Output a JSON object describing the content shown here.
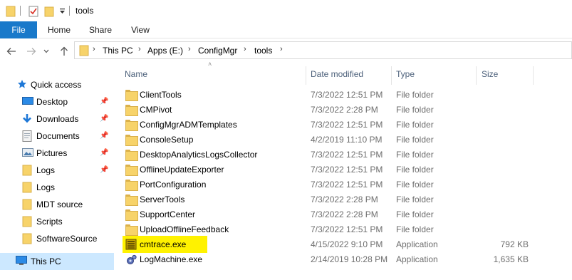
{
  "window": {
    "title": "tools"
  },
  "ribbon": {
    "tabs": [
      "File",
      "Home",
      "Share",
      "View"
    ]
  },
  "address": {
    "path": [
      "This PC",
      "Apps (E:)",
      "ConfigMgr",
      "tools"
    ]
  },
  "nav_pane": {
    "quick_access": "Quick access",
    "items": [
      {
        "label": "Desktop",
        "icon": "desktop-icon",
        "pinned": true
      },
      {
        "label": "Downloads",
        "icon": "downloads-icon",
        "pinned": true
      },
      {
        "label": "Documents",
        "icon": "documents-icon",
        "pinned": true
      },
      {
        "label": "Pictures",
        "icon": "pictures-icon",
        "pinned": true
      },
      {
        "label": "Logs",
        "icon": "folder-icon",
        "pinned": true
      },
      {
        "label": "Logs",
        "icon": "folder-icon",
        "pinned": false
      },
      {
        "label": "MDT source",
        "icon": "folder-icon",
        "pinned": false
      },
      {
        "label": "Scripts",
        "icon": "folder-icon",
        "pinned": false
      },
      {
        "label": "SoftwareSource",
        "icon": "folder-icon",
        "pinned": false
      }
    ],
    "this_pc": "This PC"
  },
  "file_list": {
    "columns": [
      "Name",
      "Date modified",
      "Type",
      "Size"
    ],
    "rows": [
      {
        "name": "ClientTools",
        "date": "7/3/2022 12:51 PM",
        "type": "File folder",
        "size": "",
        "icon": "folder-icon"
      },
      {
        "name": "CMPivot",
        "date": "7/3/2022 2:28 PM",
        "type": "File folder",
        "size": "",
        "icon": "folder-icon"
      },
      {
        "name": "ConfigMgrADMTemplates",
        "date": "7/3/2022 12:51 PM",
        "type": "File folder",
        "size": "",
        "icon": "folder-icon"
      },
      {
        "name": "ConsoleSetup",
        "date": "4/2/2019 11:10 PM",
        "type": "File folder",
        "size": "",
        "icon": "folder-icon"
      },
      {
        "name": "DesktopAnalyticsLogsCollector",
        "date": "7/3/2022 12:51 PM",
        "type": "File folder",
        "size": "",
        "icon": "folder-icon"
      },
      {
        "name": "OfflineUpdateExporter",
        "date": "7/3/2022 12:51 PM",
        "type": "File folder",
        "size": "",
        "icon": "folder-icon"
      },
      {
        "name": "PortConfiguration",
        "date": "7/3/2022 12:51 PM",
        "type": "File folder",
        "size": "",
        "icon": "folder-icon"
      },
      {
        "name": "ServerTools",
        "date": "7/3/2022 2:28 PM",
        "type": "File folder",
        "size": "",
        "icon": "folder-icon"
      },
      {
        "name": "SupportCenter",
        "date": "7/3/2022 2:28 PM",
        "type": "File folder",
        "size": "",
        "icon": "folder-icon"
      },
      {
        "name": "UploadOfflineFeedback",
        "date": "7/3/2022 12:51 PM",
        "type": "File folder",
        "size": "",
        "icon": "folder-icon"
      },
      {
        "name": "cmtrace.exe",
        "date": "4/15/2022 9:10 PM",
        "type": "Application",
        "size": "792 KB",
        "icon": "cmtrace-app-icon",
        "highlighted": true
      },
      {
        "name": "LogMachine.exe",
        "date": "2/14/2019 10:28 PM",
        "type": "Application",
        "size": "1,635 KB",
        "icon": "logmachine-app-icon"
      }
    ]
  },
  "colors": {
    "file_tab": "#1979ca",
    "selection": "#cce8ff",
    "highlight": "#fff200",
    "folder": "#f7d36a"
  }
}
